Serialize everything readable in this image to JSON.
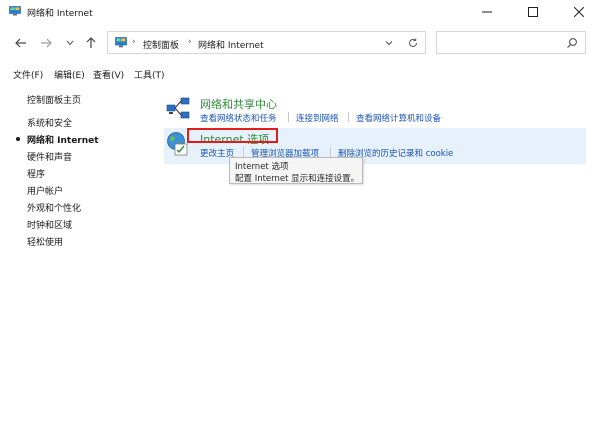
{
  "window": {
    "title": "网络和 Internet"
  },
  "address": {
    "crumbs": [
      "控制面板",
      "网络和 Internet"
    ]
  },
  "search": {
    "placeholder": ""
  },
  "menu": [
    "文件(F)",
    "编辑(E)",
    "查看(V)",
    "工具(T)"
  ],
  "sidebar": {
    "home": "控制面板主页",
    "items": [
      "系统和安全",
      "网络和 Internet",
      "硬件和声音",
      "程序",
      "用户帐户",
      "外观和个性化",
      "时钟和区域",
      "轻松使用"
    ],
    "active_index": 1
  },
  "categories": {
    "network_center": {
      "title": "网络和共享中心",
      "links": [
        "查看网络状态和任务",
        "连接到网络",
        "查看网络计算机和设备"
      ]
    },
    "internet_options": {
      "title": "Internet 选项",
      "links": [
        "更改主页",
        "管理浏览器加载项",
        "删除浏览的历史记录和 cookie"
      ]
    }
  },
  "tooltip": {
    "title": "Internet 选项",
    "description": "配置 Internet 显示和连接设置。"
  },
  "colors": {
    "category_title": "#2f8a3a",
    "link": "#1a55b8",
    "highlight": "#e6f1fb",
    "callout": "#e21b1b"
  }
}
